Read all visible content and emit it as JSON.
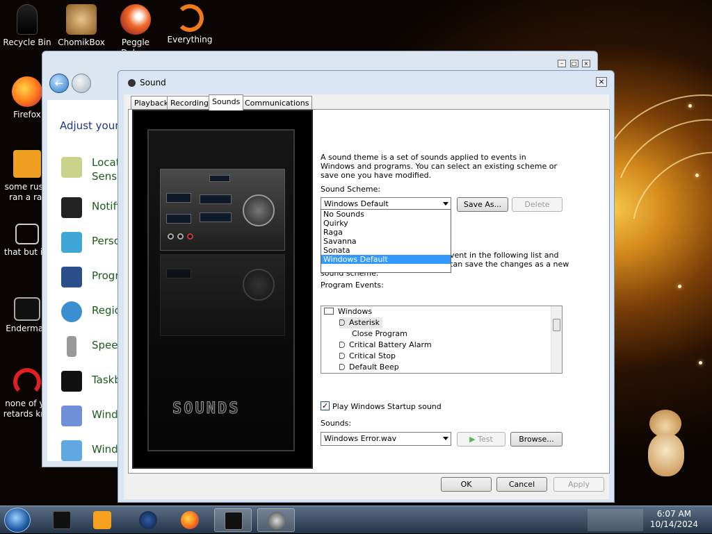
{
  "desktop_icons": [
    {
      "label": "Recycle Bin",
      "icon": "recycle-bin-icon"
    },
    {
      "label": "ChomikBox",
      "icon": "chomikbox-icon"
    },
    {
      "label": "Peggle Deluxe",
      "icon": "peggle-icon"
    },
    {
      "label": "Everything",
      "icon": "everything-icon"
    },
    {
      "label": "Firefox",
      "icon": "firefox-icon"
    },
    {
      "label": "some russi ran a rat",
      "icon": "java-icon"
    },
    {
      "label": "that but its",
      "icon": "shortcut-icon"
    },
    {
      "label": "Enderman",
      "icon": "window-icon"
    },
    {
      "label": "none of yo retards kno",
      "icon": "red-circle-icon"
    }
  ],
  "control_panel": {
    "heading": "Adjust your",
    "items": [
      "Locat Senso",
      "Notifi",
      "Perso",
      "Progr",
      "Regio",
      "Speed",
      "Taskb",
      "Windo",
      "Windo"
    ],
    "window_controls": [
      "–",
      "□",
      "×"
    ]
  },
  "dialog": {
    "title": "Sound",
    "close": "×",
    "tabs": [
      "Playback",
      "Recording",
      "Sounds",
      "Communications"
    ],
    "active_tab": "Sounds",
    "art_text": "SOUNDS",
    "description": "A sound theme is a set of sounds applied to events in Windows and programs.  You can select an existing scheme or save one you have modified.",
    "scheme_label": "Sound Scheme:",
    "scheme_value": "Windows Default",
    "scheme_options": [
      "No Sounds",
      "Quirky",
      "Raga",
      "Savanna",
      "Sonata",
      "Windows Default"
    ],
    "scheme_selected": "Windows Default",
    "save_as": "Save As...",
    "delete": "Delete",
    "hint_line1": "vent in the following list and",
    "hint_line2": "then select a sound to apply.  You can save the changes as a new",
    "hint_line3": "sound scheme.",
    "events_label": "Program Events:",
    "events": {
      "group": "Windows",
      "items": [
        "Asterisk",
        "Close Program",
        "Critical Battery Alarm",
        "Critical Stop",
        "Default Beep"
      ]
    },
    "startup_label": "Play Windows Startup sound",
    "startup_checked": "✓",
    "sounds_label": "Sounds:",
    "sound_value": "Windows Error.wav",
    "test": "Test",
    "browse": "Browse...",
    "ok": "OK",
    "cancel": "Cancel",
    "apply": "Apply"
  },
  "taskbar": {
    "apps": [
      "explorer",
      "media-player",
      "stellarium",
      "firefox",
      "sound-dialog",
      "disc"
    ],
    "time": "6:07 AM",
    "date": "10/14/2024"
  }
}
